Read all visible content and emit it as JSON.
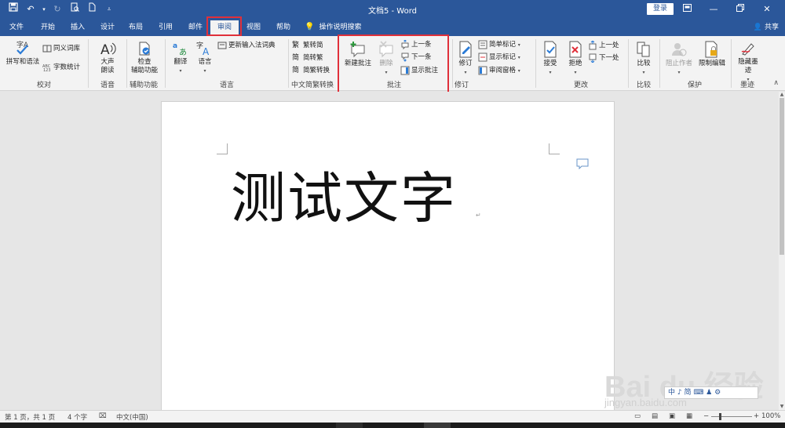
{
  "window": {
    "title": "文档5 - Word",
    "login": "登录",
    "share": "共享"
  },
  "tabs": [
    "文件",
    "开始",
    "插入",
    "设计",
    "布局",
    "引用",
    "邮件",
    "审阅",
    "视图",
    "帮助"
  ],
  "active_tab": "审阅",
  "tell_me": "操作说明搜索",
  "ribbon": {
    "proofing": {
      "spell": "拼写和语法",
      "thesaurus": "同义词库",
      "wordcount": "字数统计",
      "label": "校对"
    },
    "speech": {
      "read1": "大声",
      "read2": "朗读",
      "label": "语音"
    },
    "accessibility": {
      "check1": "检查",
      "check2": "辅助功能",
      "label": "辅助功能"
    },
    "language": {
      "translate": "翻译",
      "language": "语言",
      "update_ime": "更新输入法词典",
      "label": "语言"
    },
    "chinese_conv": {
      "t2s": "繁转简",
      "s2t": "简转繁",
      "conv": "简繁转换",
      "label": "中文简繁转换"
    },
    "comments": {
      "new": "新建批注",
      "delete": "删除",
      "prev": "上一条",
      "next": "下一条",
      "show": "显示批注",
      "label": "批注"
    },
    "tracking": {
      "track": "修订",
      "markup": "简单标记",
      "show_markup": "显示标记",
      "pane": "审阅窗格",
      "label": "修订"
    },
    "changes": {
      "accept": "接受",
      "reject": "拒绝",
      "prev": "上一处",
      "next": "下一处",
      "label": "更改"
    },
    "compare": {
      "compare": "比较",
      "label": "比较"
    },
    "protect": {
      "block": "阻止作者",
      "restrict": "限制编辑",
      "label": "保护"
    },
    "ink": {
      "hide1": "隐藏墨",
      "hide2": "迹",
      "label": "墨迹"
    }
  },
  "document": {
    "text": "测试文字"
  },
  "status": {
    "page": "第 1 页，共 1 页",
    "words": "4 个字",
    "lang": "中文(中国)",
    "zoom": "100%"
  },
  "watermark": {
    "brand": "Bai du 经验",
    "url": "jingyan.baidu.com"
  },
  "ime": "中 ♪ 简 ⌨ ♟ ⚙",
  "colors": {
    "accent": "#2b579a",
    "highlight": "#e0303a"
  }
}
